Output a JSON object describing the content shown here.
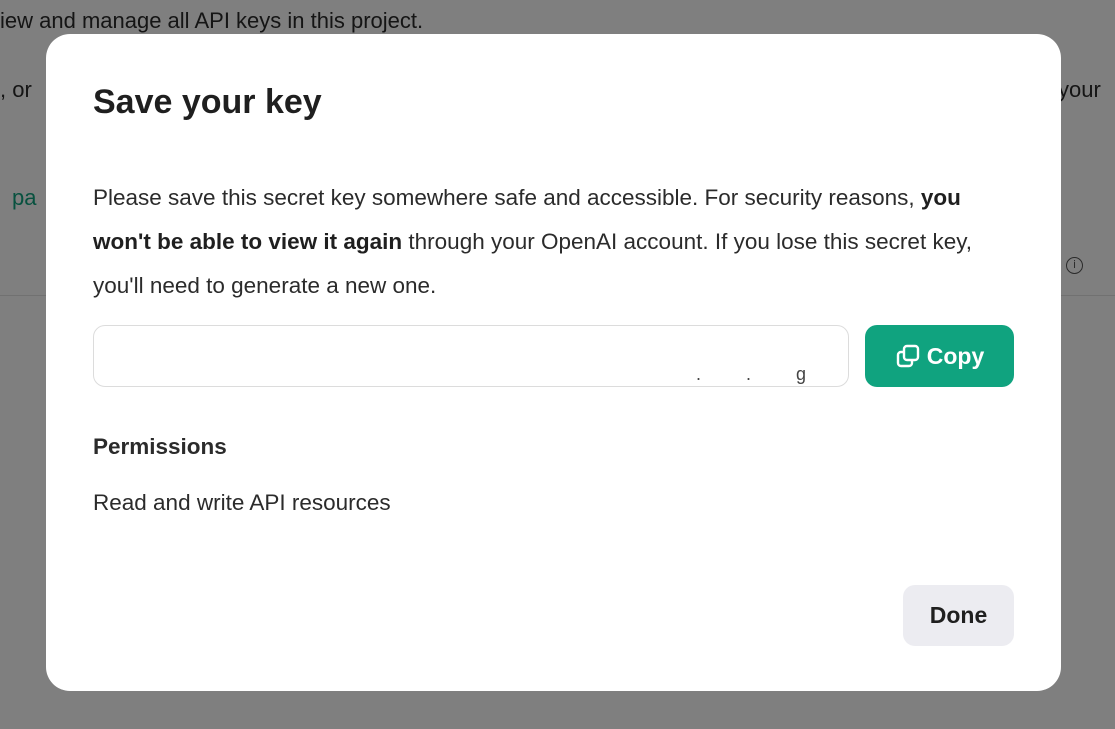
{
  "background": {
    "intro_text": "iew and manage all API keys in this project.",
    "left_fragment": ", or",
    "right_fragment": "your",
    "link_fragment": "pa"
  },
  "modal": {
    "title": "Save your key",
    "description_part1": "Please save this secret key somewhere safe and accessible. For security reasons, ",
    "description_bold": "you won't be able to view it again",
    "description_part2": " through your OpenAI account. If you lose this secret key, you'll need to generate a new one.",
    "key_field_value": "",
    "key_field_visible_marks": ". . g",
    "copy_label": "Copy",
    "permissions_heading": "Permissions",
    "permissions_value": "Read and write API resources",
    "done_label": "Done"
  },
  "icons": {
    "copy": "copy-icon",
    "info": "info-icon"
  },
  "colors": {
    "accent": "#10a37f",
    "done_bg": "#ececf1",
    "overlay": "rgba(0,0,0,0.5)"
  }
}
